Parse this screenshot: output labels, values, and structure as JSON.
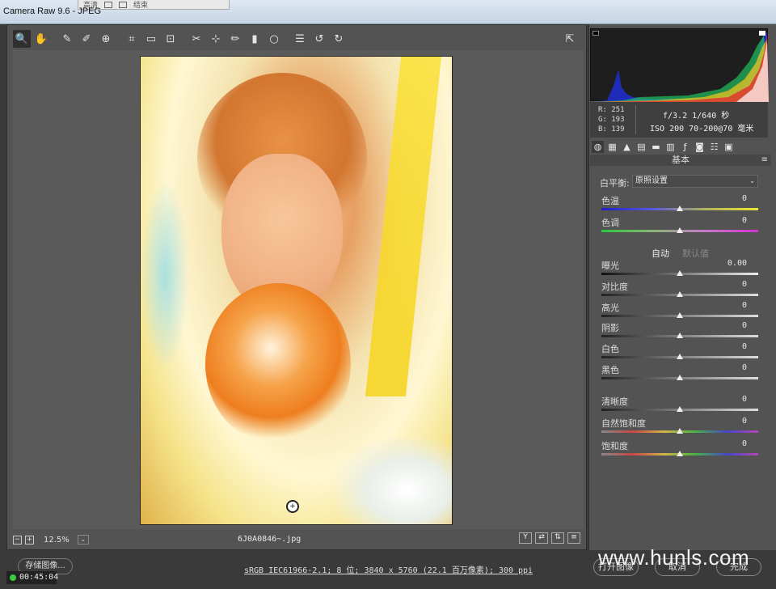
{
  "window": {
    "title": "Camera Raw 9.6 - JPEG",
    "ghost_menu": [
      "高清",
      "结束"
    ]
  },
  "toolbar": {
    "tools": [
      "zoom-icon",
      "hand-icon",
      "white-balance-icon",
      "color-sampler-icon",
      "target-adjust-icon",
      "crop-icon",
      "straighten-icon",
      "transform-icon",
      "spot-removal-icon",
      "red-eye-icon",
      "adjustment-brush-icon",
      "graduated-filter-icon",
      "radial-filter-icon",
      "presets-icon",
      "rotate-ccw-icon",
      "rotate-cw-icon"
    ],
    "fullscreen": "fullscreen-icon"
  },
  "histogram": {
    "rgb": {
      "r": "R:  251",
      "g": "G:  193",
      "b": "B:  139"
    },
    "camera_line1": "f/3.2   1/640 秒",
    "camera_line2": "ISO 200   70-200@70 毫米"
  },
  "panel": {
    "section_title": "基本",
    "white_balance_label": "白平衡:",
    "white_balance_value": "原照设置",
    "auto": "自动",
    "default": "默认值",
    "sliders": [
      {
        "label": "色温",
        "value": "0",
        "level": 0.5
      },
      {
        "label": "色调",
        "value": "0",
        "level": 0.5
      },
      {
        "label": "曝光",
        "value": "0.00",
        "level": 0.5
      },
      {
        "label": "对比度",
        "value": "0",
        "level": 0.5
      },
      {
        "label": "高光",
        "value": "0",
        "level": 0.5
      },
      {
        "label": "阴影",
        "value": "0",
        "level": 0.5
      },
      {
        "label": "白色",
        "value": "0",
        "level": 0.5
      },
      {
        "label": "黑色",
        "value": "0",
        "level": 0.5
      },
      {
        "label": "清晰度",
        "value": "0",
        "level": 0.5
      },
      {
        "label": "自然饱和度",
        "value": "0",
        "level": 0.5
      },
      {
        "label": "饱和度",
        "value": "0",
        "level": 0.5
      }
    ]
  },
  "status": {
    "zoom": "12.5%",
    "filename": "6J0A0846~.jpg",
    "view_label": "Y"
  },
  "footer": {
    "save": "存储图像...",
    "timer": "00:45:04",
    "meta": "sRGB IEC61966-2.1; 8 位; 3840 x 5760 (22.1 百万像素); 300 ppi",
    "open": "打开图像",
    "cancel": "取消",
    "done": "完成",
    "watermark": "www.hunls.com"
  },
  "colors": {
    "accent": "#535353",
    "temp_blue": "#1e1ec8",
    "temp_yellow": "#e8e832"
  }
}
